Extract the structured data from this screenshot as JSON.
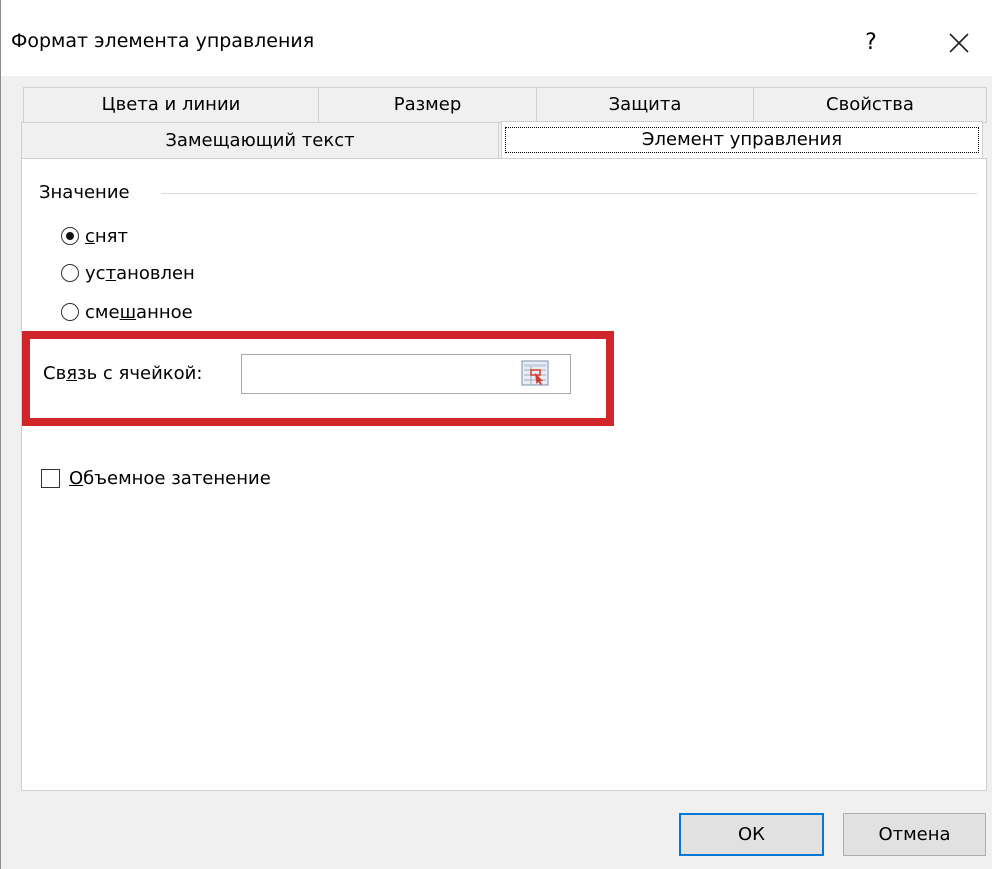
{
  "window": {
    "title": "Формат элемента управления",
    "help_label": "?"
  },
  "tabs_row1": [
    {
      "label": "Цвета и линии"
    },
    {
      "label": "Размер"
    },
    {
      "label": "Защита"
    },
    {
      "label": "Свойства"
    }
  ],
  "tabs_row2": [
    {
      "label": "Замещающий текст"
    },
    {
      "label": "Элемент управления",
      "selected": true
    }
  ],
  "value_group": {
    "label": "Значение",
    "options": [
      {
        "pre": "",
        "accel": "с",
        "post": "нят",
        "checked": true
      },
      {
        "pre": "ус",
        "accel": "т",
        "post": "ановлен",
        "checked": false
      },
      {
        "pre": "сме",
        "accel": "ш",
        "post": "анное",
        "checked": false
      }
    ]
  },
  "cell_link": {
    "label_pre": "Св",
    "label_accel": "я",
    "label_post": "зь с ячейкой:",
    "value": ""
  },
  "shading": {
    "accel": "О",
    "post": "бъемное затенение",
    "checked": false
  },
  "buttons": {
    "ok": "ОК",
    "cancel": "Отмена"
  },
  "colors": {
    "highlight": "#d0252b",
    "focus": "#0078d7"
  }
}
